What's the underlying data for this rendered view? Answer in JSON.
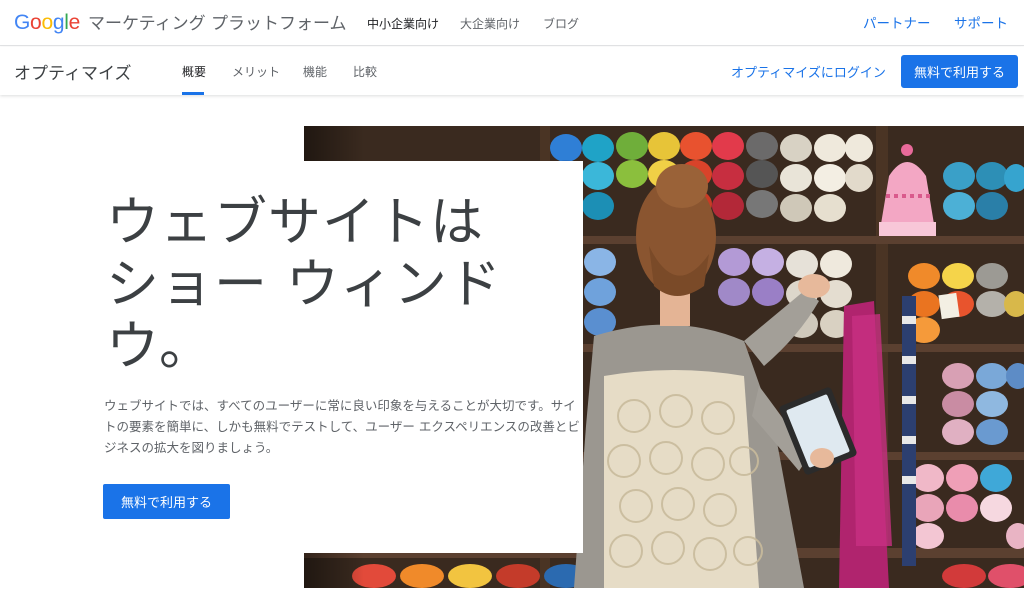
{
  "header": {
    "logo_letters": [
      {
        "char": "G",
        "color": "#4285F4"
      },
      {
        "char": "o",
        "color": "#EA4335"
      },
      {
        "char": "o",
        "color": "#FBBC05"
      },
      {
        "char": "g",
        "color": "#4285F4"
      },
      {
        "char": "l",
        "color": "#34A853"
      },
      {
        "char": "e",
        "color": "#EA4335"
      }
    ],
    "brand_title": "マーケティング プラットフォーム",
    "nav": [
      "中小企業向け",
      "大企業向け",
      "ブログ"
    ],
    "right_links": [
      "パートナー",
      "サポート"
    ]
  },
  "product_bar": {
    "product_name": "オプティマイズ",
    "tabs": [
      "概要",
      "メリット",
      "機能",
      "比較"
    ],
    "active_tab": "概要",
    "login_label": "オプティマイズにログイン",
    "cta_label": "無料で利用する"
  },
  "hero": {
    "headline_lines": [
      "ウェブサイトは",
      "ショー ウィンド",
      "ウ。"
    ],
    "body": "ウェブサイトでは、すべてのユーザーに常に良い印象を与えることが大切です。サイトの要素を簡単に、しかも無料でテストして、ユーザー エクスペリエンスの改善とビジネスの拡大を図りましょう。",
    "cta_label": "無料で利用する",
    "image": "woman-browsing-yarn-shelves-with-tablet"
  },
  "colors": {
    "accent": "#1a73e8",
    "text": "#202124",
    "muted": "#5f6368"
  }
}
